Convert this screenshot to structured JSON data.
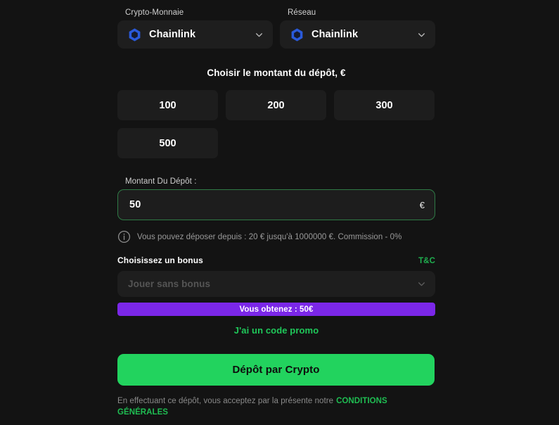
{
  "colors": {
    "page_bg": "#131313",
    "surface": "#1d1d1d",
    "accent_green": "#22d35e",
    "link_green": "#1fc85a",
    "tc_green": "#1faf4f",
    "bonus_purple": "#7b27e8",
    "chainlink_blue": "#2a5ada",
    "input_border_green": "#2f7a46",
    "muted_text": "#9a9a9a"
  },
  "crypto": {
    "label": "Crypto-Monnaie",
    "value": "Chainlink",
    "icon": "chainlink-hexagon-icon",
    "chevron": "chevron-down-icon"
  },
  "network": {
    "label": "Réseau",
    "value": "Chainlink",
    "icon": "chainlink-hexagon-icon",
    "chevron": "chevron-down-icon"
  },
  "amounts": {
    "heading": "Choisir le montant du dépôt, €",
    "presets": [
      "100",
      "200",
      "300",
      "500"
    ]
  },
  "amount_input": {
    "label": "Montant Du Dépôt :",
    "value": "50",
    "placeholder": "",
    "currency": "€"
  },
  "hint": {
    "icon": "info-circle-icon",
    "text": "Vous pouvez déposer depuis : 20 € jusqu'à 1000000 €. Commission - 0%"
  },
  "bonus": {
    "title": "Choisissez un bonus",
    "tc_label": "T&C",
    "placeholder": "Jouer sans bonus",
    "chevron": "chevron-down-icon",
    "reward_text": "Vous obtenez : 50€",
    "promo_label": "J'ai un code promo"
  },
  "submit": {
    "label": "Dépôt par Crypto"
  },
  "terms": {
    "text": "En effectuant ce dépôt, vous acceptez par la présente notre",
    "link": "CONDITIONS GÉNÉRALES"
  }
}
